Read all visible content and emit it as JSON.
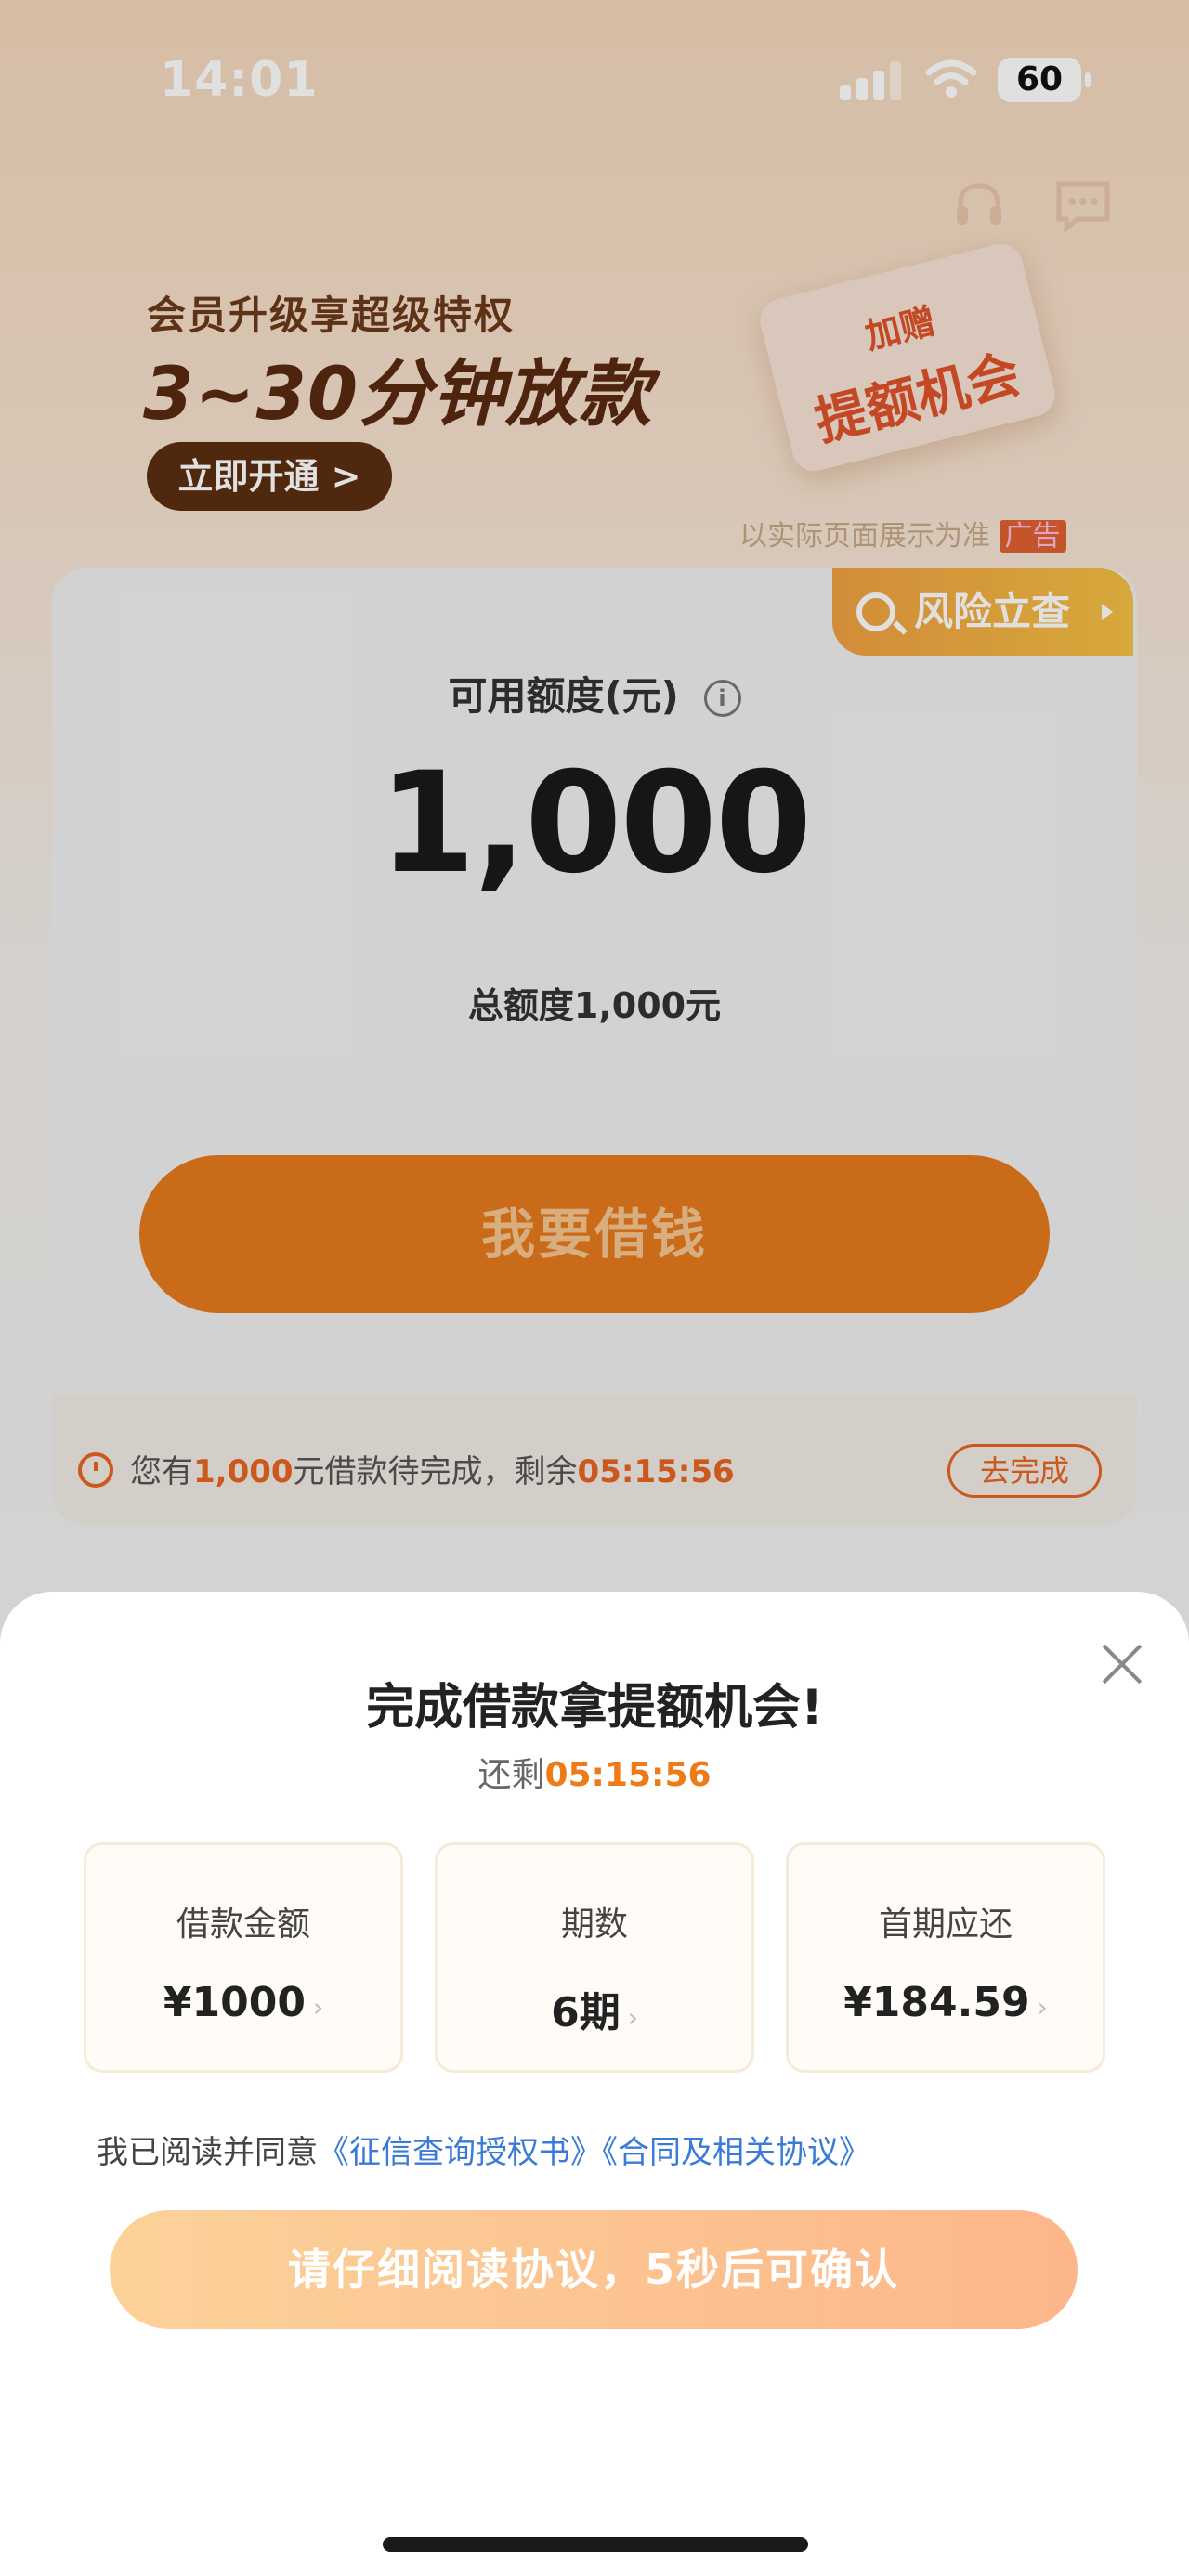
{
  "status_bar": {
    "time": "14:01",
    "battery": "60"
  },
  "icons": {
    "headset": "headset-icon",
    "chat": "chat-icon",
    "info": "info-icon",
    "search": "search-icon",
    "clock": "clock-icon",
    "close": "close-icon"
  },
  "banner": {
    "subtitle": "会员升级享超级特权",
    "title": "3~30分钟放款",
    "button": "立即开通 >",
    "coupon_line1": "加赠",
    "coupon_line2": "提额机会",
    "note": "以实际页面展示为准",
    "note_tag": "广告"
  },
  "card": {
    "risk_tag": "风险立查",
    "available_label": "可用额度(元)",
    "info_glyph": "i",
    "amount": "1,000",
    "total": "总额度1,000元",
    "borrow_button": "我要借钱",
    "pending_prefix": "您有",
    "pending_amount": "1,000",
    "pending_mid": "元借款待完成，剩余",
    "pending_time": "05:15:56",
    "complete_button": "去完成"
  },
  "sheet": {
    "title": "完成借款拿提额机会!",
    "remain_label": "还剩",
    "remain_time": "05:15:56",
    "boxes": [
      {
        "label": "借款金额",
        "value": "¥1000"
      },
      {
        "label": "期数",
        "value": "6期"
      },
      {
        "label": "首期应还",
        "value": "¥184.59"
      }
    ],
    "agree_prefix": "我已阅读并同意",
    "link1": "《征信查询授权书》",
    "link2": "《合同及相关协议》",
    "confirm_button": "请仔细阅读协议，5秒后可确认"
  },
  "colors": {
    "accent": "#e67a1e",
    "link": "#3a7bd8",
    "countdown": "#ef7a18"
  }
}
